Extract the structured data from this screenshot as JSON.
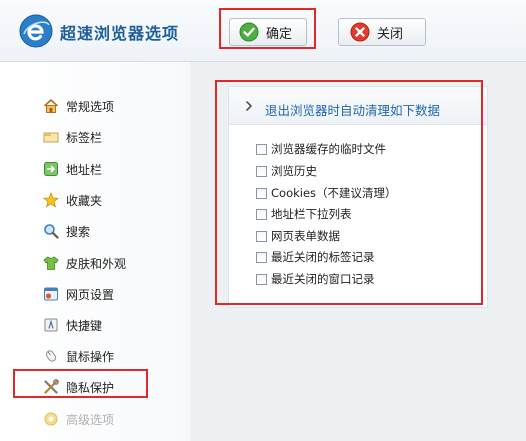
{
  "header": {
    "title": "超速浏览器选项",
    "ok_label": "确定",
    "close_label": "关闭"
  },
  "sidebar": {
    "items": [
      {
        "label": "常规选项",
        "icon": "home-icon"
      },
      {
        "label": "标签栏",
        "icon": "tab-bar-icon"
      },
      {
        "label": "地址栏",
        "icon": "address-bar-icon"
      },
      {
        "label": "收藏夹",
        "icon": "star-icon"
      },
      {
        "label": "搜索",
        "icon": "search-icon"
      },
      {
        "label": "皮肤和外观",
        "icon": "shirt-icon"
      },
      {
        "label": "网页设置",
        "icon": "webpage-icon"
      },
      {
        "label": "快捷键",
        "icon": "shortcut-icon"
      },
      {
        "label": "鼠标操作",
        "icon": "mouse-icon"
      },
      {
        "label": "隐私保护",
        "icon": "tools-icon"
      },
      {
        "label": "高级选项",
        "icon": "advanced-gear-icon"
      }
    ]
  },
  "panel": {
    "title": "退出浏览器时自动清理如下数据",
    "options": [
      {
        "label": "浏览器缓存的临时文件",
        "checked": false
      },
      {
        "label": "浏览历史",
        "checked": false
      },
      {
        "label": "Cookies（不建议清理）",
        "checked": false
      },
      {
        "label": "地址栏下拉列表",
        "checked": false
      },
      {
        "label": "网页表单数据",
        "checked": false
      },
      {
        "label": "最近关闭的标签记录",
        "checked": false
      },
      {
        "label": "最近关闭的窗口记录",
        "checked": false
      }
    ]
  },
  "colors": {
    "highlight_border": "#e02a2a",
    "title_blue": "#1e5f9a",
    "panel_title_blue": "#1f67ad"
  }
}
